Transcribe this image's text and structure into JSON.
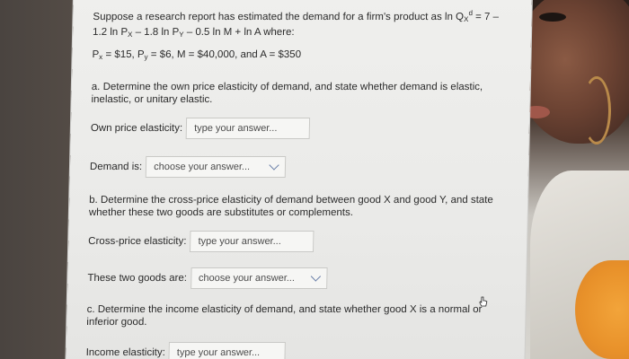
{
  "question": {
    "intro_line1": "Suppose a research report has estimated the demand for a firm's product as ln Q",
    "intro_line1_sub": "X",
    "intro_line1_sup": "d",
    "intro_line1_end": " = 7 –",
    "intro_line2": "1.2 ln P",
    "intro_line2_sub_x": "X",
    "intro_line2_mid": " – 1.8 ln P",
    "intro_line2_sub_y": "Y",
    "intro_line2_end": " – 0.5 ln M + ln A where:",
    "values_px": "P",
    "values_px_sub": "x",
    "values_px_rest": " = $15, P",
    "values_py_sub": "y",
    "values_rest": " = $6, M = $40,000, and A = $350"
  },
  "part_a": {
    "text_line1": "a. Determine the own price elasticity of demand, and state whether demand is elastic,",
    "text_line2": "inelastic, or unitary elastic.",
    "elasticity_label": "Own price elasticity:",
    "elasticity_placeholder": "type your answer...",
    "demand_label": "Demand is:",
    "demand_select": "choose your answer..."
  },
  "part_b": {
    "text_line1": "b. Determine the cross-price elasticity of demand between good X and good Y, and state",
    "text_line2": "whether these two goods are substitutes or complements.",
    "elasticity_label": "Cross-price elasticity:",
    "elasticity_placeholder": "type your answer...",
    "goods_label": "These two goods are:",
    "goods_select": "choose your answer..."
  },
  "part_c": {
    "text_line1": "c. Determine the income elasticity of demand, and state whether good X is a normal or",
    "text_line2": "inferior good.",
    "elasticity_label": "Income elasticity:",
    "elasticity_placeholder": "type your answer..."
  },
  "icons": {
    "chevron": "chevron-down-icon",
    "cursor": "hand-cursor-icon"
  },
  "colors": {
    "screen_bg": "#eeeeec",
    "text": "#2b2b2b",
    "field_border": "#c9c9c6",
    "chevron": "#6a7fa8"
  }
}
